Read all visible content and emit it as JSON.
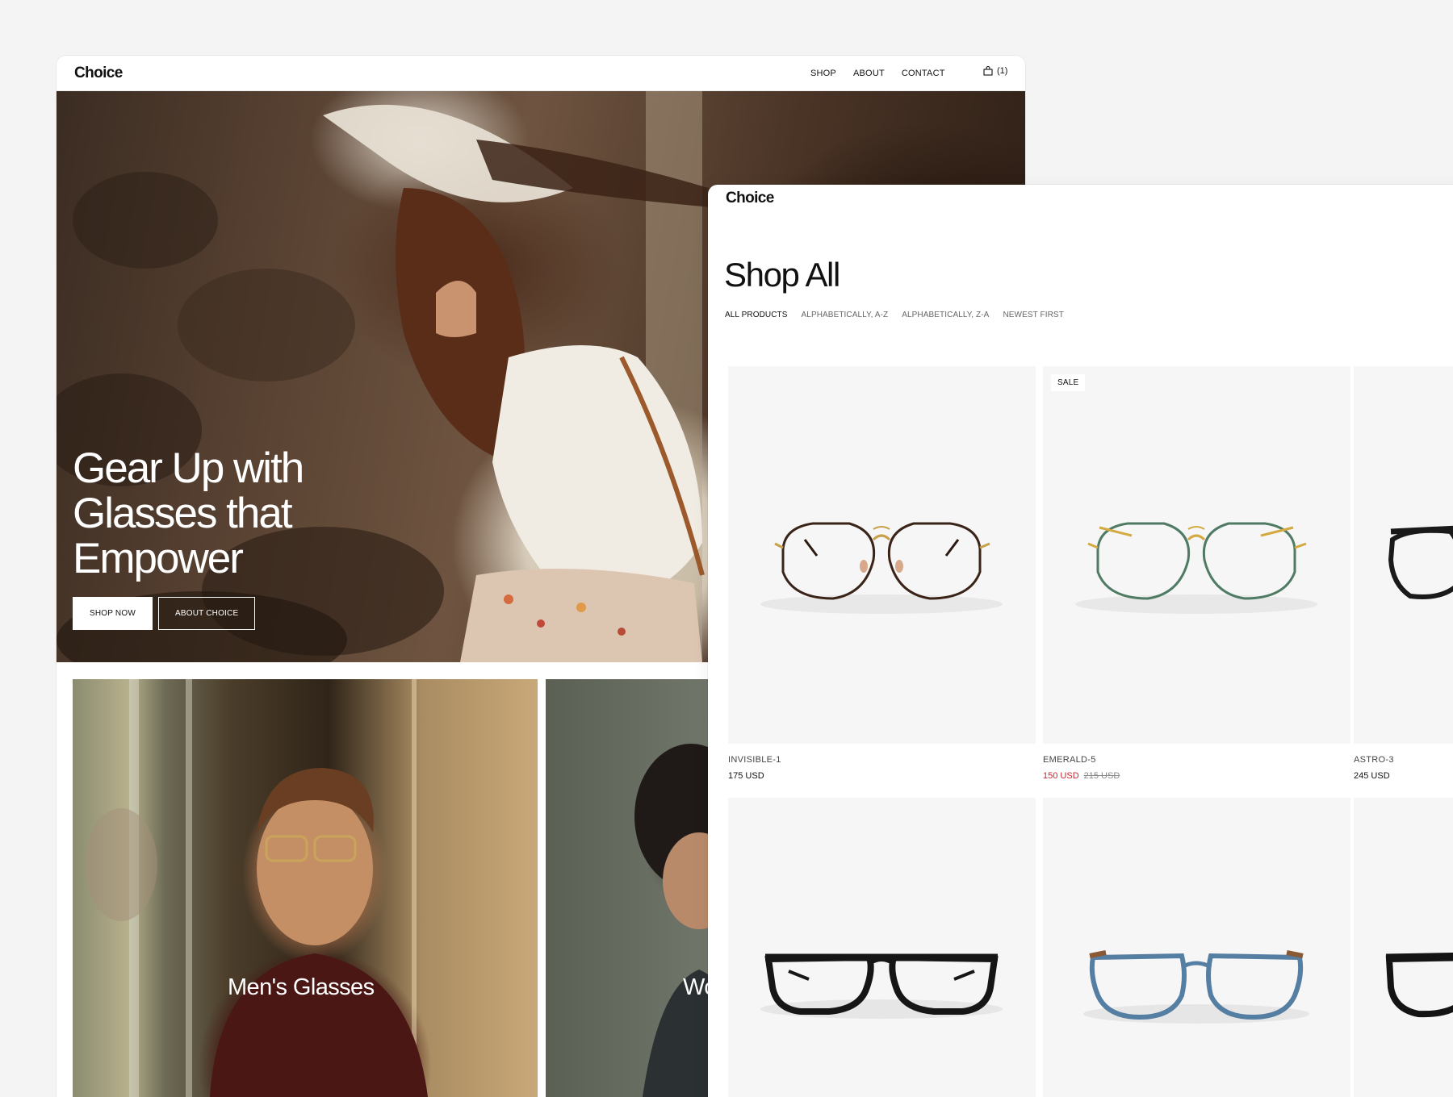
{
  "home": {
    "logo": "Choice",
    "nav": [
      "SHOP",
      "ABOUT",
      "CONTACT"
    ],
    "cart_count": "(1)",
    "hero_title": "Gear Up with Glasses that Empower",
    "btn_shop": "SHOP NOW",
    "btn_about": "ABOUT CHOICE",
    "categories": [
      "Men's Glasses",
      "Wo"
    ]
  },
  "shop": {
    "logo": "Choice",
    "title": "Shop All",
    "sort": [
      "ALL PRODUCTS",
      "ALPHABETICALLY, A-Z",
      "ALPHABETICALLY, Z-A",
      "NEWEST FIRST"
    ],
    "products": [
      {
        "name": "INVISIBLE-1",
        "price": "175 USD"
      },
      {
        "name": "EMERALD-5",
        "badge": "SALE",
        "price": "150 USD",
        "old_price": "215 USD"
      },
      {
        "name": "ASTRO-3",
        "price": "245 USD"
      }
    ]
  },
  "colors": {
    "sale": "#d0202a",
    "bg": "#f4f4f4",
    "card": "#f6f6f6"
  }
}
